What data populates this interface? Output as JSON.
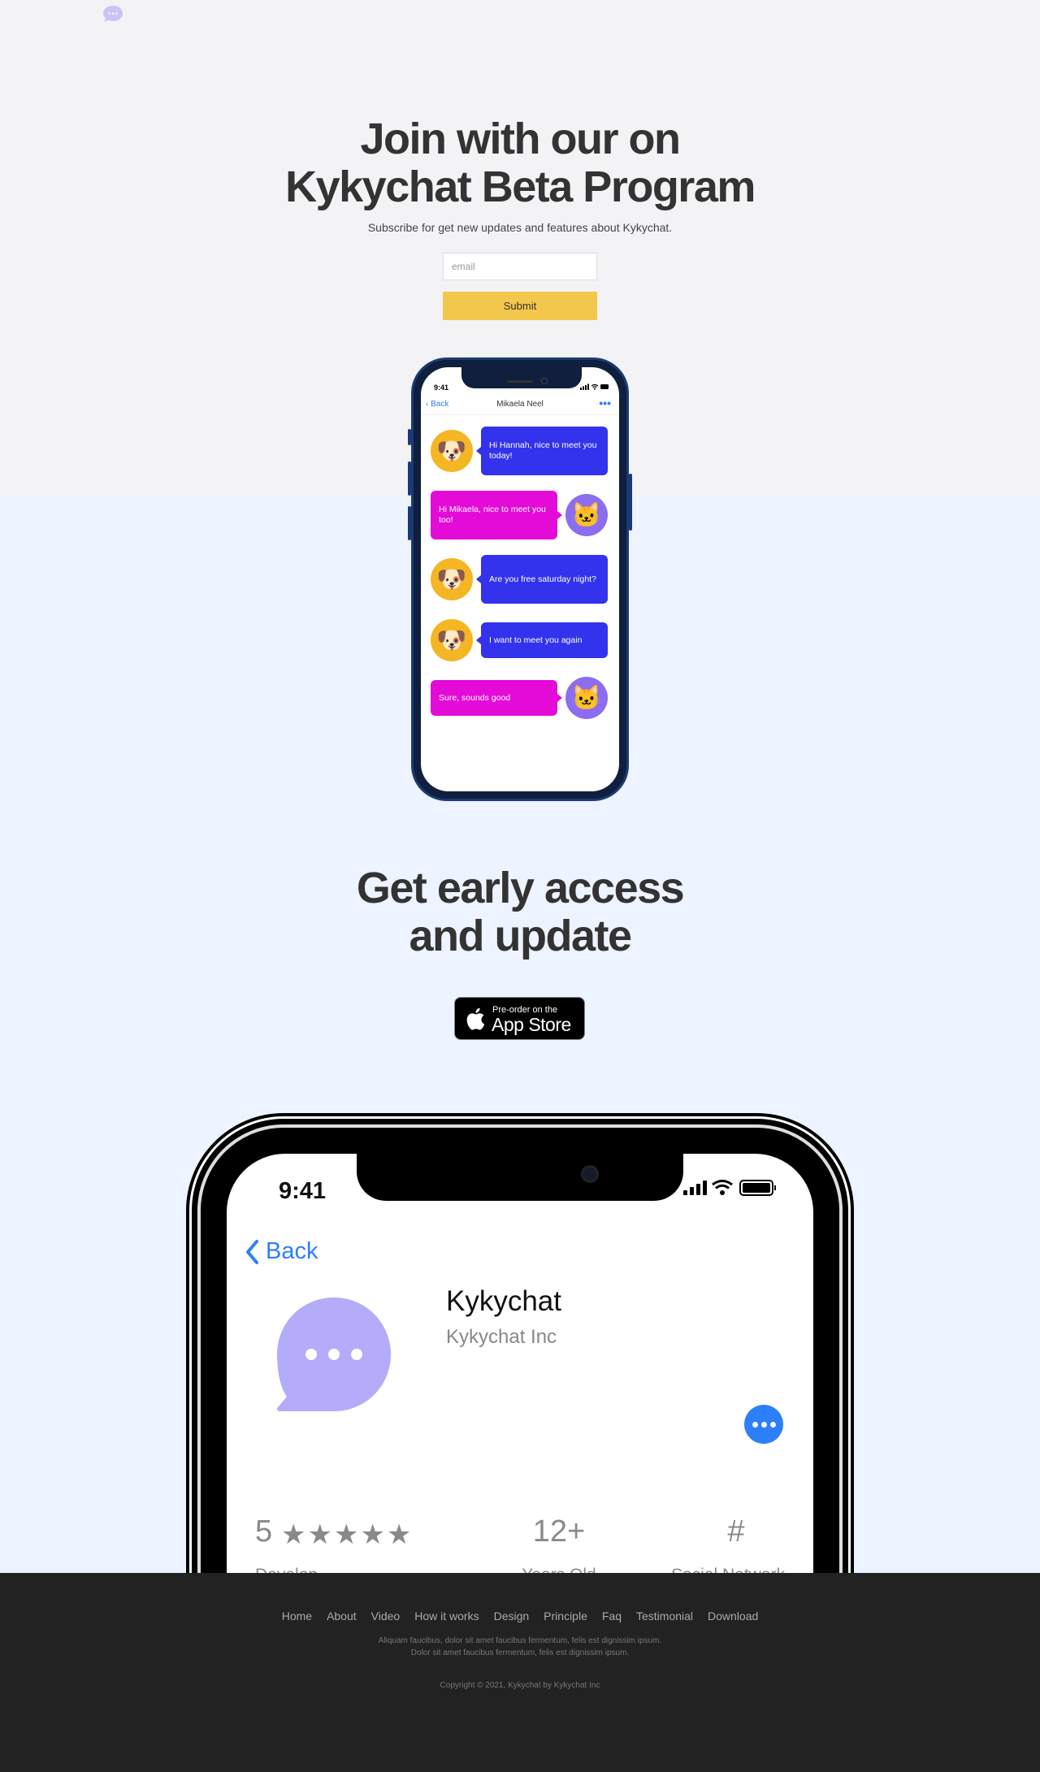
{
  "brand": {
    "logo_icon": "chat-bubble-icon",
    "accent": "#f3c64c",
    "primary": "#2d7ff9"
  },
  "hero": {
    "title_line1": "Join with our on",
    "title_line2": "Kykychat Beta Program",
    "subtitle": "Subscribe for get new updates and features about Kykychat.",
    "email_placeholder": "email",
    "email_value": "",
    "submit_label": "Submit"
  },
  "chat_phone": {
    "time": "9:41",
    "status_icons": "signal wifi battery",
    "back_label": "Back",
    "contact_name": "Mikaela Neel",
    "more_icon": "•••",
    "messages": [
      {
        "side": "left",
        "avatar": "dog-emoji-icon",
        "text": "Hi Hannah, nice to meet you today!"
      },
      {
        "side": "right",
        "avatar": "cat-emoji-icon",
        "text": "Hi Mikaela, nice to meet you too!"
      },
      {
        "side": "left",
        "avatar": "dog-emoji-icon",
        "text": "Are you free saturday night?"
      },
      {
        "side": "left",
        "avatar": "dog-emoji-icon",
        "text": "I want to meet you again"
      },
      {
        "side": "right",
        "avatar": "cat-emoji-icon",
        "text": "Sure, sounds good"
      }
    ]
  },
  "access": {
    "title_line1": "Get early access",
    "title_line2": "and update",
    "appstore_top": "Pre-order on the",
    "appstore_main": "App Store"
  },
  "app_phone": {
    "time": "9:41",
    "back_label": "Back",
    "app_name": "Kykychat",
    "company": "Kykychat Inc",
    "rating_value": "5",
    "rating_stars": "★★★★★",
    "rating_label": "Develop",
    "age_value": "12+",
    "age_label": "Years Old",
    "category_value": "#",
    "category_label": "Social Network"
  },
  "footer": {
    "nav": [
      "Home",
      "About",
      "Video",
      "How it works",
      "Design",
      "Principle",
      "Faq",
      "Testimonial",
      "Download"
    ],
    "desc_line1": "Aliquam faucibus, dolor sit amet faucibus fermentum, felis est dignissim ipsum.",
    "desc_line2": "Dolor sit amet faucibus fermentum, felis est dignissim ipsum.",
    "copyright": "Copyright © 2021, Kykychat by Kykychat Inc"
  }
}
